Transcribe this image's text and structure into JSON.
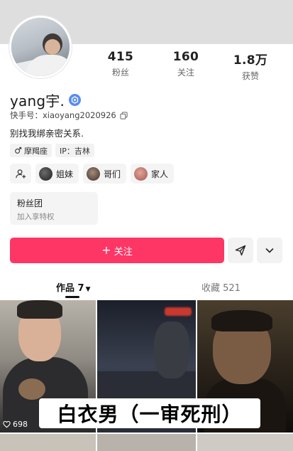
{
  "profile": {
    "username": "yang宇.",
    "kuaishou_id": "快手号：xiaoyang2020926",
    "bio": "别找我绑亲密关系.",
    "tags": [
      "摩羯座",
      "IP：吉林"
    ]
  },
  "stats": [
    {
      "value": "415",
      "label": "粉丝"
    },
    {
      "value": "160",
      "label": "关注"
    },
    {
      "value": "1.8万",
      "label": "获赞"
    }
  ],
  "relations": [
    {
      "label": "姐妹"
    },
    {
      "label": "哥们"
    },
    {
      "label": "家人"
    }
  ],
  "fan_club": {
    "title": "粉丝团",
    "subtitle": "加入享特权"
  },
  "actions": {
    "follow_label": "关注"
  },
  "tabs": {
    "works_label": "作品 7",
    "favorites_label": "收藏 521"
  },
  "videos": [
    {
      "likes": "698"
    }
  ],
  "overlay_caption": "白衣男（一审死刑）",
  "colors": {
    "accent": "#fe3666",
    "verified": "#5a8dee"
  },
  "icons": [
    "verified-badge-icon",
    "copy-icon",
    "male-icon",
    "add-friend-icon",
    "send-icon",
    "chevron-down-icon",
    "heart-icon",
    "caret-down-icon"
  ]
}
